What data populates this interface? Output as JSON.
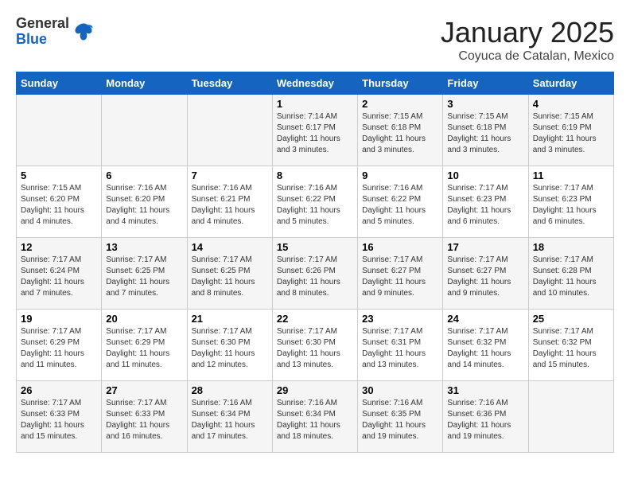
{
  "header": {
    "logo_general": "General",
    "logo_blue": "Blue",
    "title": "January 2025",
    "location": "Coyuca de Catalan, Mexico"
  },
  "days_of_week": [
    "Sunday",
    "Monday",
    "Tuesday",
    "Wednesday",
    "Thursday",
    "Friday",
    "Saturday"
  ],
  "weeks": [
    [
      {
        "day": "",
        "info": ""
      },
      {
        "day": "",
        "info": ""
      },
      {
        "day": "",
        "info": ""
      },
      {
        "day": "1",
        "info": "Sunrise: 7:14 AM\nSunset: 6:17 PM\nDaylight: 11 hours and 3 minutes."
      },
      {
        "day": "2",
        "info": "Sunrise: 7:15 AM\nSunset: 6:18 PM\nDaylight: 11 hours and 3 minutes."
      },
      {
        "day": "3",
        "info": "Sunrise: 7:15 AM\nSunset: 6:18 PM\nDaylight: 11 hours and 3 minutes."
      },
      {
        "day": "4",
        "info": "Sunrise: 7:15 AM\nSunset: 6:19 PM\nDaylight: 11 hours and 3 minutes."
      }
    ],
    [
      {
        "day": "5",
        "info": "Sunrise: 7:15 AM\nSunset: 6:20 PM\nDaylight: 11 hours and 4 minutes."
      },
      {
        "day": "6",
        "info": "Sunrise: 7:16 AM\nSunset: 6:20 PM\nDaylight: 11 hours and 4 minutes."
      },
      {
        "day": "7",
        "info": "Sunrise: 7:16 AM\nSunset: 6:21 PM\nDaylight: 11 hours and 4 minutes."
      },
      {
        "day": "8",
        "info": "Sunrise: 7:16 AM\nSunset: 6:22 PM\nDaylight: 11 hours and 5 minutes."
      },
      {
        "day": "9",
        "info": "Sunrise: 7:16 AM\nSunset: 6:22 PM\nDaylight: 11 hours and 5 minutes."
      },
      {
        "day": "10",
        "info": "Sunrise: 7:17 AM\nSunset: 6:23 PM\nDaylight: 11 hours and 6 minutes."
      },
      {
        "day": "11",
        "info": "Sunrise: 7:17 AM\nSunset: 6:23 PM\nDaylight: 11 hours and 6 minutes."
      }
    ],
    [
      {
        "day": "12",
        "info": "Sunrise: 7:17 AM\nSunset: 6:24 PM\nDaylight: 11 hours and 7 minutes."
      },
      {
        "day": "13",
        "info": "Sunrise: 7:17 AM\nSunset: 6:25 PM\nDaylight: 11 hours and 7 minutes."
      },
      {
        "day": "14",
        "info": "Sunrise: 7:17 AM\nSunset: 6:25 PM\nDaylight: 11 hours and 8 minutes."
      },
      {
        "day": "15",
        "info": "Sunrise: 7:17 AM\nSunset: 6:26 PM\nDaylight: 11 hours and 8 minutes."
      },
      {
        "day": "16",
        "info": "Sunrise: 7:17 AM\nSunset: 6:27 PM\nDaylight: 11 hours and 9 minutes."
      },
      {
        "day": "17",
        "info": "Sunrise: 7:17 AM\nSunset: 6:27 PM\nDaylight: 11 hours and 9 minutes."
      },
      {
        "day": "18",
        "info": "Sunrise: 7:17 AM\nSunset: 6:28 PM\nDaylight: 11 hours and 10 minutes."
      }
    ],
    [
      {
        "day": "19",
        "info": "Sunrise: 7:17 AM\nSunset: 6:29 PM\nDaylight: 11 hours and 11 minutes."
      },
      {
        "day": "20",
        "info": "Sunrise: 7:17 AM\nSunset: 6:29 PM\nDaylight: 11 hours and 11 minutes."
      },
      {
        "day": "21",
        "info": "Sunrise: 7:17 AM\nSunset: 6:30 PM\nDaylight: 11 hours and 12 minutes."
      },
      {
        "day": "22",
        "info": "Sunrise: 7:17 AM\nSunset: 6:30 PM\nDaylight: 11 hours and 13 minutes."
      },
      {
        "day": "23",
        "info": "Sunrise: 7:17 AM\nSunset: 6:31 PM\nDaylight: 11 hours and 13 minutes."
      },
      {
        "day": "24",
        "info": "Sunrise: 7:17 AM\nSunset: 6:32 PM\nDaylight: 11 hours and 14 minutes."
      },
      {
        "day": "25",
        "info": "Sunrise: 7:17 AM\nSunset: 6:32 PM\nDaylight: 11 hours and 15 minutes."
      }
    ],
    [
      {
        "day": "26",
        "info": "Sunrise: 7:17 AM\nSunset: 6:33 PM\nDaylight: 11 hours and 15 minutes."
      },
      {
        "day": "27",
        "info": "Sunrise: 7:17 AM\nSunset: 6:33 PM\nDaylight: 11 hours and 16 minutes."
      },
      {
        "day": "28",
        "info": "Sunrise: 7:16 AM\nSunset: 6:34 PM\nDaylight: 11 hours and 17 minutes."
      },
      {
        "day": "29",
        "info": "Sunrise: 7:16 AM\nSunset: 6:34 PM\nDaylight: 11 hours and 18 minutes."
      },
      {
        "day": "30",
        "info": "Sunrise: 7:16 AM\nSunset: 6:35 PM\nDaylight: 11 hours and 19 minutes."
      },
      {
        "day": "31",
        "info": "Sunrise: 7:16 AM\nSunset: 6:36 PM\nDaylight: 11 hours and 19 minutes."
      },
      {
        "day": "",
        "info": ""
      }
    ]
  ]
}
